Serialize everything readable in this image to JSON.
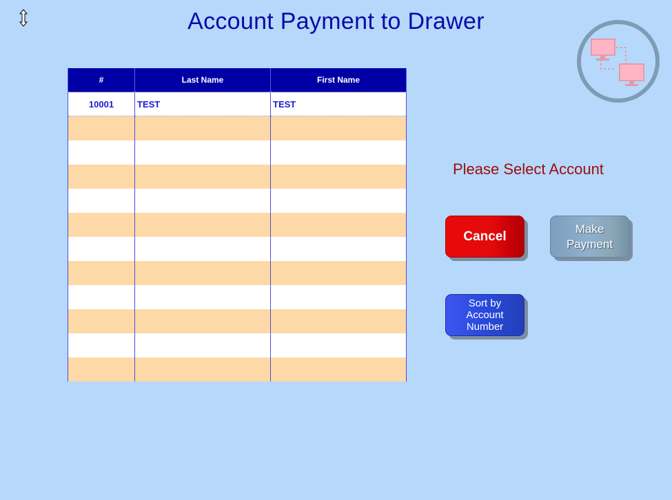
{
  "page": {
    "title": "Account Payment to Drawer",
    "prompt": "Please Select Account"
  },
  "icons": {
    "resize": "vertical-resize-icon",
    "network": "network-connection-icon"
  },
  "table": {
    "headers": {
      "number": "#",
      "last_name": "Last Name",
      "first_name": "First Name"
    },
    "rows": [
      {
        "number": "10001",
        "last_name": "TEST",
        "first_name": "TEST"
      },
      {
        "number": "",
        "last_name": "",
        "first_name": ""
      },
      {
        "number": "",
        "last_name": "",
        "first_name": ""
      },
      {
        "number": "",
        "last_name": "",
        "first_name": ""
      },
      {
        "number": "",
        "last_name": "",
        "first_name": ""
      },
      {
        "number": "",
        "last_name": "",
        "first_name": ""
      },
      {
        "number": "",
        "last_name": "",
        "first_name": ""
      },
      {
        "number": "",
        "last_name": "",
        "first_name": ""
      },
      {
        "number": "",
        "last_name": "",
        "first_name": ""
      },
      {
        "number": "",
        "last_name": "",
        "first_name": ""
      },
      {
        "number": "",
        "last_name": "",
        "first_name": ""
      },
      {
        "number": "",
        "last_name": "",
        "first_name": ""
      }
    ]
  },
  "buttons": {
    "cancel": "Cancel",
    "make_payment": "Make\nPayment",
    "sort": "Sort by\nAccount\nNumber"
  },
  "colors": {
    "background": "#b6d8fb",
    "header": "#0000a6",
    "row_alt": "#fed9a8",
    "cancel": "#e3090b",
    "sort": "#2849dc"
  }
}
